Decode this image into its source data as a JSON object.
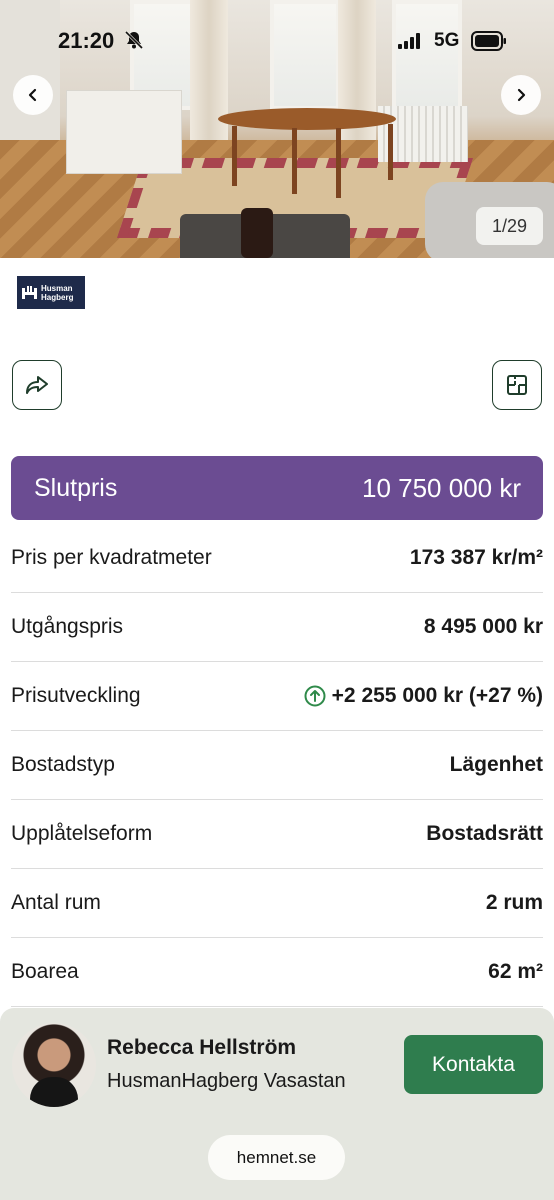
{
  "status_bar": {
    "time": "21:20",
    "network": "5G"
  },
  "gallery": {
    "counter": "1/29"
  },
  "agency": {
    "logo_line1": "Husman",
    "logo_line2": "Hagberg"
  },
  "price": {
    "label": "Slutpris",
    "value": "10 750 000 kr"
  },
  "details": [
    {
      "key": "Pris per kvadratmeter",
      "value": "173 387 kr/m²"
    },
    {
      "key": "Utgångspris",
      "value": "8 495 000 kr"
    },
    {
      "key": "Prisutveckling",
      "value": "+2 255 000 kr (+27 %)"
    },
    {
      "key": "Bostadstyp",
      "value": "Lägenhet"
    },
    {
      "key": "Upplåtelseform",
      "value": "Bostadsrätt"
    },
    {
      "key": "Antal rum",
      "value": "2 rum"
    },
    {
      "key": "Boarea",
      "value": "62 m²"
    }
  ],
  "contact": {
    "agent_name": "Rebecca Hellström",
    "agent_office": "HusmanHagberg Vasastan",
    "button_label": "Kontakta"
  },
  "browser": {
    "url": "hemnet.se"
  },
  "colors": {
    "accent_purple": "#6b4c92",
    "accent_green": "#2f7d4e",
    "dark_green": "#1f3d2b"
  }
}
